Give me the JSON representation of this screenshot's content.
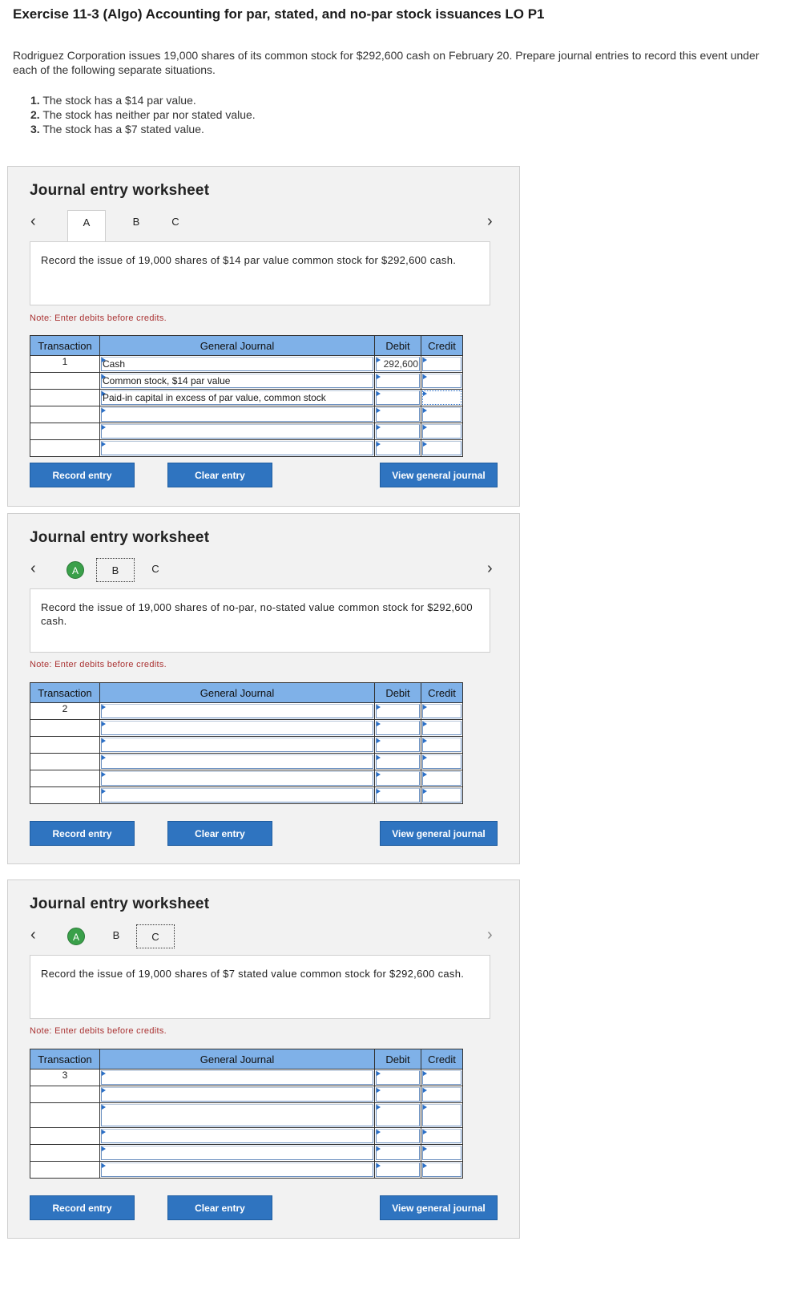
{
  "header": {
    "title": "Exercise 11-3 (Algo) Accounting for par, stated, and no-par stock issuances LO P1",
    "intro": "Rodriguez Corporation issues 19,000 shares of its common stock for $292,600 cash on February 20. Prepare journal entries to record this event under each of the following separate situations.",
    "requirements": [
      {
        "num": "1.",
        "text": " The stock has a $14 par value."
      },
      {
        "num": "2.",
        "text": " The stock has neither par nor stated value."
      },
      {
        "num": "3.",
        "text": " The stock has a $7 stated value."
      }
    ]
  },
  "worksheets": [
    {
      "title": "Journal entry worksheet",
      "tabs": [
        "A",
        "B",
        "C"
      ],
      "description": "Record the issue of 19,000 shares of $14 par value common stock for $292,600 cash.",
      "note": "Note: Enter debits before credits.",
      "columns": {
        "transaction": "Transaction",
        "journal": "General Journal",
        "debit": "Debit",
        "credit": "Credit"
      },
      "transaction_no": "1",
      "rows": [
        {
          "account": "Cash",
          "debit": "292,600",
          "credit": ""
        },
        {
          "account": "Common stock, $14 par value",
          "debit": "",
          "credit": ""
        },
        {
          "account": "Paid-in capital in excess of par value, common stock",
          "debit": "",
          "credit": ""
        },
        {
          "account": "",
          "debit": "",
          "credit": ""
        },
        {
          "account": "",
          "debit": "",
          "credit": ""
        },
        {
          "account": "",
          "debit": "",
          "credit": ""
        }
      ],
      "buttons": {
        "record": "Record entry",
        "clear": "Clear entry",
        "view": "View general journal"
      }
    },
    {
      "title": "Journal entry worksheet",
      "tabs": [
        "A",
        "B",
        "C"
      ],
      "description": "Record the issue of 19,000 shares of no-par, no-stated value common stock for $292,600 cash.",
      "note": "Note: Enter debits before credits.",
      "columns": {
        "transaction": "Transaction",
        "journal": "General Journal",
        "debit": "Debit",
        "credit": "Credit"
      },
      "transaction_no": "2",
      "buttons": {
        "record": "Record entry",
        "clear": "Clear entry",
        "view": "View general journal"
      }
    },
    {
      "title": "Journal entry worksheet",
      "tabs": [
        "A",
        "B",
        "C"
      ],
      "description": "Record the issue of 19,000 shares of $7 stated value common stock for $292,600 cash.",
      "note": "Note: Enter debits before credits.",
      "columns": {
        "transaction": "Transaction",
        "journal": "General Journal",
        "debit": "Debit",
        "credit": "Credit"
      },
      "transaction_no": "3",
      "buttons": {
        "record": "Record entry",
        "clear": "Clear entry",
        "view": "View general journal"
      }
    }
  ]
}
